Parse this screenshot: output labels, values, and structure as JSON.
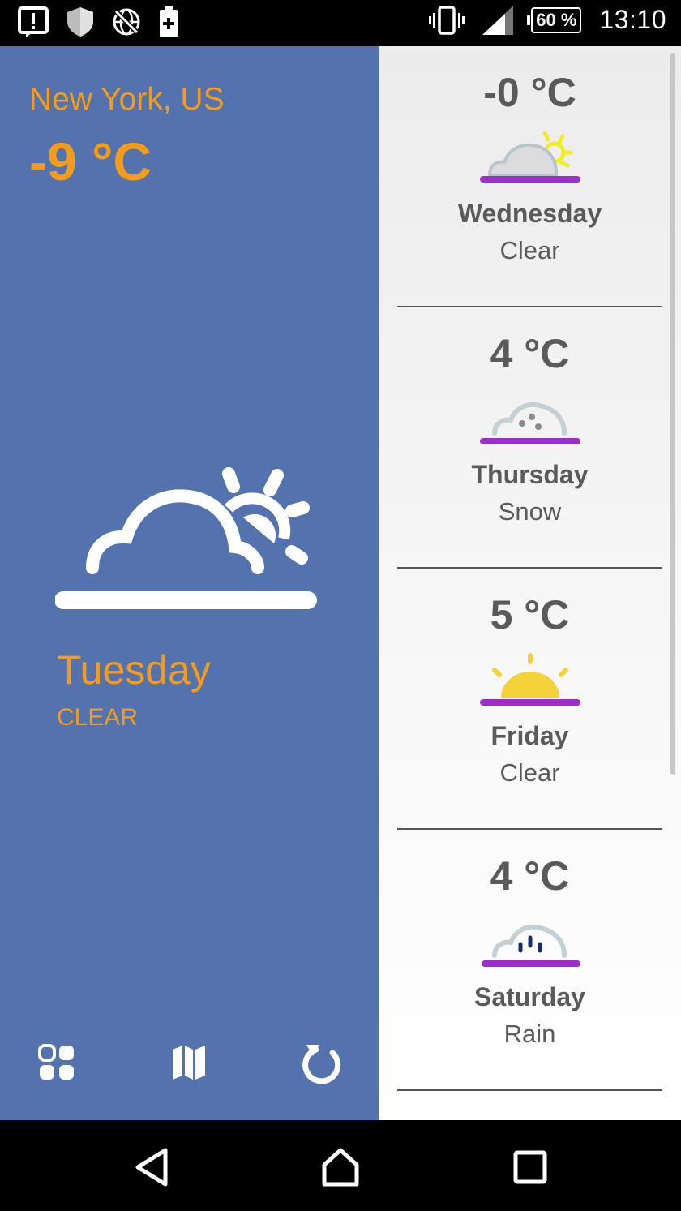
{
  "status_bar": {
    "battery_percent": "60 %",
    "time": "13:10"
  },
  "current": {
    "city": "New York, US",
    "temperature": "-9 °C",
    "day": "Tuesday",
    "condition": "CLEAR",
    "icon": "partly-cloudy-icon"
  },
  "toolbar": {
    "items": [
      "dashboard-icon",
      "map-icon",
      "refresh-icon"
    ]
  },
  "forecast": [
    {
      "temperature": "-0 °C",
      "day": "Wednesday",
      "condition": "Clear",
      "icon": "partly-cloudy-icon"
    },
    {
      "temperature": "4 °C",
      "day": "Thursday",
      "condition": "Snow",
      "icon": "snow-cloud-icon"
    },
    {
      "temperature": "5 °C",
      "day": "Friday",
      "condition": "Clear",
      "icon": "sunrise-icon"
    },
    {
      "temperature": "4 °C",
      "day": "Saturday",
      "condition": "Rain",
      "icon": "rain-cloud-icon"
    }
  ],
  "colors": {
    "accent": "#f39c1b",
    "panel": "#5472ae",
    "underline": "#9b2fc9",
    "sun": "#f3d23a"
  }
}
